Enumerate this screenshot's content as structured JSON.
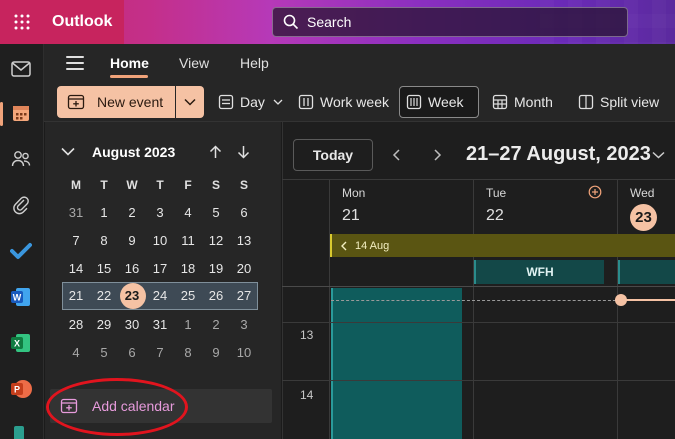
{
  "app": {
    "name": "Outlook"
  },
  "search": {
    "placeholder": "Search"
  },
  "nav_tabs": [
    {
      "label": "Home",
      "active": true
    },
    {
      "label": "View",
      "active": false
    },
    {
      "label": "Help",
      "active": false
    }
  ],
  "ribbon": {
    "new_event": "New event",
    "day": "Day",
    "work_week": "Work week",
    "week": "Week",
    "month": "Month",
    "split_view": "Split view"
  },
  "mini_calendar": {
    "month_label": "August 2023",
    "weekdays": [
      "M",
      "T",
      "W",
      "T",
      "F",
      "S",
      "S"
    ],
    "weeks": [
      [
        "31",
        "1",
        "2",
        "3",
        "4",
        "5",
        "6"
      ],
      [
        "7",
        "8",
        "9",
        "10",
        "11",
        "12",
        "13"
      ],
      [
        "14",
        "15",
        "16",
        "17",
        "18",
        "19",
        "20"
      ],
      [
        "21",
        "22",
        "23",
        "24",
        "25",
        "26",
        "27"
      ],
      [
        "28",
        "29",
        "30",
        "31",
        "1",
        "2",
        "3"
      ],
      [
        "4",
        "5",
        "6",
        "7",
        "8",
        "9",
        "10"
      ]
    ],
    "today": "23"
  },
  "sidebar": {
    "add_calendar": "Add calendar"
  },
  "calendar": {
    "today_button": "Today",
    "range_title": "21–27 August, 2023",
    "days": [
      {
        "name": "Mon",
        "number": "21"
      },
      {
        "name": "Tue",
        "number": "22"
      },
      {
        "name": "Wed",
        "number": "23"
      }
    ],
    "banner_event": "14 Aug",
    "wfh_event": "WFH",
    "hours": [
      "13",
      "14"
    ]
  },
  "colors": {
    "accent": "#f5c2a4",
    "brand": "#c7245e"
  }
}
